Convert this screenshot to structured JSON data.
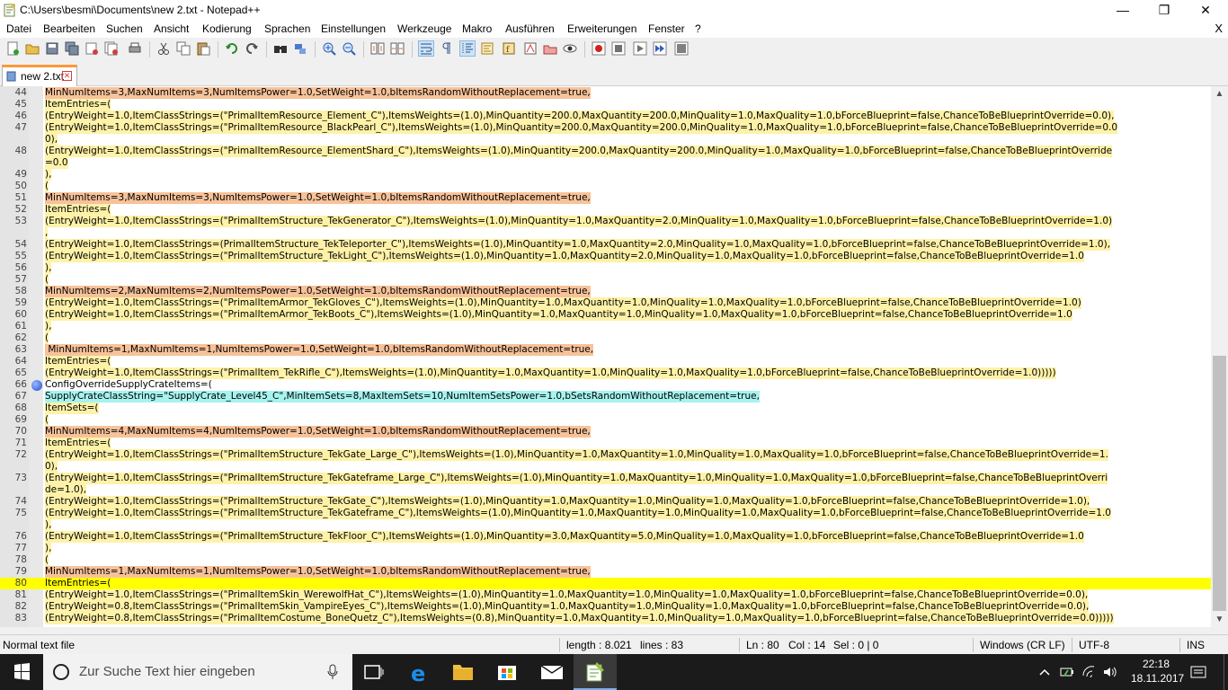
{
  "window": {
    "title": "C:\\Users\\besmi\\Documents\\new 2.txt - Notepad++",
    "minimize_glyph": "—",
    "restore_glyph": "❐",
    "close_glyph": "✕"
  },
  "menu": {
    "items": [
      "Datei",
      "Bearbeiten",
      "Suchen",
      "Ansicht",
      "Kodierung",
      "Sprachen",
      "Einstellungen",
      "Werkzeuge",
      "Makro",
      "Ausführen",
      "Erweiterungen",
      "Fenster",
      "?"
    ],
    "close_glyph": "X"
  },
  "toolbar": {
    "icons": [
      "new-file-icon",
      "open-file-icon",
      "save-icon",
      "save-all-icon",
      "close-icon",
      "close-all-icon",
      "print-icon",
      "cut-icon",
      "copy-icon",
      "paste-icon",
      "undo-icon",
      "redo-icon",
      "find-icon",
      "replace-icon",
      "zoom-in-icon",
      "zoom-out-icon",
      "sync-vertical-icon",
      "sync-horizontal-icon",
      "word-wrap-icon",
      "show-all-chars-icon",
      "indent-guide-icon",
      "doc-map-icon",
      "function-list-icon",
      "folder-workspace-icon",
      "monitor-icon",
      "record-macro-icon",
      "stop-macro-icon",
      "play-macro-icon",
      "play-multiple-icon",
      "save-macro-icon"
    ]
  },
  "tab": {
    "label": "new 2.txt",
    "close_glyph": "✕"
  },
  "editor": {
    "lines": [
      {
        "n": "44",
        "text": "MinNumItems=3,MaxNumItems=3,NumItemsPower=1.0,SetWeight=1.0,bItemsRandomWithoutReplacement=true,",
        "style": "hs"
      },
      {
        "n": "45",
        "text": "ItemEntries=(",
        "style": "hl"
      },
      {
        "n": "46",
        "text": "(EntryWeight=1.0,ItemClassStrings=(\"PrimalItemResource_Element_C\"),ItemsWeights=(1.0),MinQuantity=200.0,MaxQuantity=200.0,MinQuality=1.0,MaxQuality=1.0,bForceBlueprint=false,ChanceToBeBlueprintOverride=0.0),",
        "style": "hl"
      },
      {
        "n": "47",
        "text": "(EntryWeight=1.0,ItemClassStrings=(\"PrimalItemResource_BlackPearl_C\"),ItemsWeights=(1.0),MinQuantity=200.0,MaxQuantity=200.0,MinQuality=1.0,MaxQuality=1.0,bForceBlueprint=false,ChanceToBeBlueprintOverride=0.0",
        "style": "hl"
      },
      {
        "n": "",
        "text": "0),",
        "style": "hl"
      },
      {
        "n": "48",
        "text": "(EntryWeight=1.0,ItemClassStrings=(\"PrimalItemResource_ElementShard_C\"),ItemsWeights=(1.0),MinQuantity=200.0,MaxQuantity=200.0,MinQuality=1.0,MaxQuality=1.0,bForceBlueprint=false,ChanceToBeBlueprintOverride",
        "style": "hl"
      },
      {
        "n": "",
        "text": "=0.0",
        "style": "hl"
      },
      {
        "n": "49",
        "text": "),",
        "style": "hl"
      },
      {
        "n": "50",
        "text": "(",
        "style": "hl"
      },
      {
        "n": "51",
        "text": "MinNumItems=3,MaxNumItems=3,NumItemsPower=1.0,SetWeight=1.0,bItemsRandomWithoutReplacement=true,",
        "style": "hs"
      },
      {
        "n": "52",
        "text": "ItemEntries=(",
        "style": "hl"
      },
      {
        "n": "53",
        "text": "(EntryWeight=1.0,ItemClassStrings=(\"PrimalItemStructure_TekGenerator_C\"),ItemsWeights=(1.0),MinQuantity=1.0,MaxQuantity=2.0,MinQuality=1.0,MaxQuality=1.0,bForceBlueprint=false,ChanceToBeBlueprintOverride=1.0)",
        "style": "hl"
      },
      {
        "n": "",
        "text": ",",
        "style": "hl"
      },
      {
        "n": "54",
        "text": "(EntryWeight=1.0,ItemClassStrings=(PrimalItemStructure_TekTeleporter_C\"),ItemsWeights=(1.0),MinQuantity=1.0,MaxQuantity=2.0,MinQuality=1.0,MaxQuality=1.0,bForceBlueprint=false,ChanceToBeBlueprintOverride=1.0),",
        "style": "hl"
      },
      {
        "n": "55",
        "text": "(EntryWeight=1.0,ItemClassStrings=(\"PrimalItemStructure_TekLight_C\"),ItemsWeights=(1.0),MinQuantity=1.0,MaxQuantity=2.0,MinQuality=1.0,MaxQuality=1.0,bForceBlueprint=false,ChanceToBeBlueprintOverride=1.0",
        "style": "hl"
      },
      {
        "n": "56",
        "text": "),",
        "style": "hl"
      },
      {
        "n": "57",
        "text": "(",
        "style": "hl"
      },
      {
        "n": "58",
        "text": "MinNumItems=2,MaxNumItems=2,NumItemsPower=1.0,SetWeight=1.0,bItemsRandomWithoutReplacement=true,",
        "style": "hs"
      },
      {
        "n": "59",
        "text": "(EntryWeight=1.0,ItemClassStrings=(\"PrimalItemArmor_TekGloves_C\"),ItemsWeights=(1.0),MinQuantity=1.0,MaxQuantity=1.0,MinQuality=1.0,MaxQuality=1.0,bForceBlueprint=false,ChanceToBeBlueprintOverride=1.0)",
        "style": "hl"
      },
      {
        "n": "60",
        "text": "(EntryWeight=1.0,ItemClassStrings=(\"PrimalItemArmor_TekBoots_C\"),ItemsWeights=(1.0),MinQuantity=1.0,MaxQuantity=1.0,MinQuality=1.0,MaxQuality=1.0,bForceBlueprint=false,ChanceToBeBlueprintOverride=1.0",
        "style": "hl"
      },
      {
        "n": "61",
        "text": "),",
        "style": "hl"
      },
      {
        "n": "62",
        "text": "(",
        "style": "hl"
      },
      {
        "n": "63",
        "text": " MinNumItems=1,MaxNumItems=1,NumItemsPower=1.0,SetWeight=1.0,bItemsRandomWithoutReplacement=true,",
        "style": "hs"
      },
      {
        "n": "64",
        "text": "ItemEntries=(",
        "style": "hl"
      },
      {
        "n": "65",
        "text": "(EntryWeight=1.0,ItemClassStrings=(\"PrimalItem_TekRifle_C\"),ItemsWeights=(1.0),MinQuantity=1.0,MaxQuantity=1.0,MinQuality=1.0,MaxQuality=1.0,bForceBlueprint=false,ChanceToBeBlueprintOverride=1.0)))))",
        "style": "hl"
      },
      {
        "n": "66",
        "text": "ConfigOverrideSupplyCrateItems=(",
        "style": "",
        "bookmark": true
      },
      {
        "n": "67",
        "text": "SupplyCrateClassString=\"SupplyCrate_Level45_C\",MinItemSets=8,MaxItemSets=10,NumItemSetsPower=1.0,bSetsRandomWithoutReplacement=true,",
        "style": "hc"
      },
      {
        "n": "68",
        "text": "ItemSets=(",
        "style": "hl"
      },
      {
        "n": "69",
        "text": "(",
        "style": "hl"
      },
      {
        "n": "70",
        "text": "MinNumItems=4,MaxNumItems=4,NumItemsPower=1.0,SetWeight=1.0,bItemsRandomWithoutReplacement=true,",
        "style": "hs"
      },
      {
        "n": "71",
        "text": "ItemEntries=(",
        "style": "hl"
      },
      {
        "n": "72",
        "text": "(EntryWeight=1.0,ItemClassStrings=(\"PrimalItemStructure_TekGate_Large_C\"),ItemsWeights=(1.0),MinQuantity=1.0,MaxQuantity=1.0,MinQuality=1.0,MaxQuality=1.0,bForceBlueprint=false,ChanceToBeBlueprintOverride=1.",
        "style": "hl"
      },
      {
        "n": "",
        "text": "0),",
        "style": "hl"
      },
      {
        "n": "73",
        "text": "(EntryWeight=1.0,ItemClassStrings=(\"PrimalItemStructure_TekGateframe_Large_C\"),ItemsWeights=(1.0),MinQuantity=1.0,MaxQuantity=1.0,MinQuality=1.0,MaxQuality=1.0,bForceBlueprint=false,ChanceToBeBlueprintOverri",
        "style": "hl"
      },
      {
        "n": "",
        "text": "de=1.0),",
        "style": "hl"
      },
      {
        "n": "74",
        "text": "(EntryWeight=1.0,ItemClassStrings=(\"PrimalItemStructure_TekGate_C\"),ItemsWeights=(1.0),MinQuantity=1.0,MaxQuantity=1.0,MinQuality=1.0,MaxQuality=1.0,bForceBlueprint=false,ChanceToBeBlueprintOverride=1.0),",
        "style": "hl"
      },
      {
        "n": "75",
        "text": "(EntryWeight=1.0,ItemClassStrings=(\"PrimalItemStructure_TekGateframe_C\"),ItemsWeights=(1.0),MinQuantity=1.0,MaxQuantity=1.0,MinQuality=1.0,MaxQuality=1.0,bForceBlueprint=false,ChanceToBeBlueprintOverride=1.0",
        "style": "hl"
      },
      {
        "n": "",
        "text": "),",
        "style": "hl"
      },
      {
        "n": "76",
        "text": "(EntryWeight=1.0,ItemClassStrings=(\"PrimalItemStructure_TekFloor_C\"),ItemsWeights=(1.0),MinQuantity=3.0,MaxQuantity=5.0,MinQuality=1.0,MaxQuality=1.0,bForceBlueprint=false,ChanceToBeBlueprintOverride=1.0",
        "style": "hl"
      },
      {
        "n": "77",
        "text": "),",
        "style": "hl"
      },
      {
        "n": "78",
        "text": "(",
        "style": "hl"
      },
      {
        "n": "79",
        "text": "MinNumItems=1,MaxNumItems=1,NumItemsPower=1.0,SetWeight=1.0,bItemsRandomWithoutReplacement=true,",
        "style": "hs"
      },
      {
        "n": "80",
        "text": "ItemEntries=(",
        "style": "current"
      },
      {
        "n": "81",
        "text": "(EntryWeight=1.0,ItemClassStrings=(\"PrimalItemSkin_WerewolfHat_C\"),ItemsWeights=(1.0),MinQuantity=1.0,MaxQuantity=1.0,MinQuality=1.0,MaxQuality=1.0,bForceBlueprint=false,ChanceToBeBlueprintOverride=0.0),",
        "style": "hl"
      },
      {
        "n": "82",
        "text": "(EntryWeight=0.8,ItemClassStrings=(\"PrimalItemSkin_VampireEyes_C\"),ItemsWeights=(1.0),MinQuantity=1.0,MaxQuantity=1.0,MinQuality=1.0,MaxQuality=1.0,bForceBlueprint=false,ChanceToBeBlueprintOverride=0.0),",
        "style": "hl"
      },
      {
        "n": "83",
        "text": "(EntryWeight=0.8,ItemClassStrings=(\"PrimalItemCostume_BoneQuetz_C\"),ItemsWeights=(0.8),MinQuantity=1.0,MaxQuantity=1.0,MinQuality=1.0,MaxQuality=1.0,bForceBlueprint=false,ChanceToBeBlueprintOverride=0.0)))))",
        "style": "hl"
      }
    ]
  },
  "scrollbar": {
    "up_glyph": "▲",
    "down_glyph": "▼"
  },
  "status": {
    "type": "Normal text file",
    "length": "length : 8.021",
    "lines": "lines : 83",
    "ln": "Ln : 80",
    "col": "Col : 14",
    "sel": "Sel : 0 | 0",
    "eol": "Windows (CR LF)",
    "encoding": "UTF-8",
    "mode": "INS"
  },
  "taskbar": {
    "search_placeholder": "Zur Suche Text hier eingeben",
    "time": "22:18",
    "date": "18.11.2017"
  },
  "colors": {
    "line_highlight": "#fff2a8",
    "set_highlight": "#f7c29a",
    "crate_highlight": "#a6f3ef",
    "current_line": "#ffff00",
    "tab_accent": "#fa9a3a",
    "taskbar": "#1b1b1b"
  }
}
